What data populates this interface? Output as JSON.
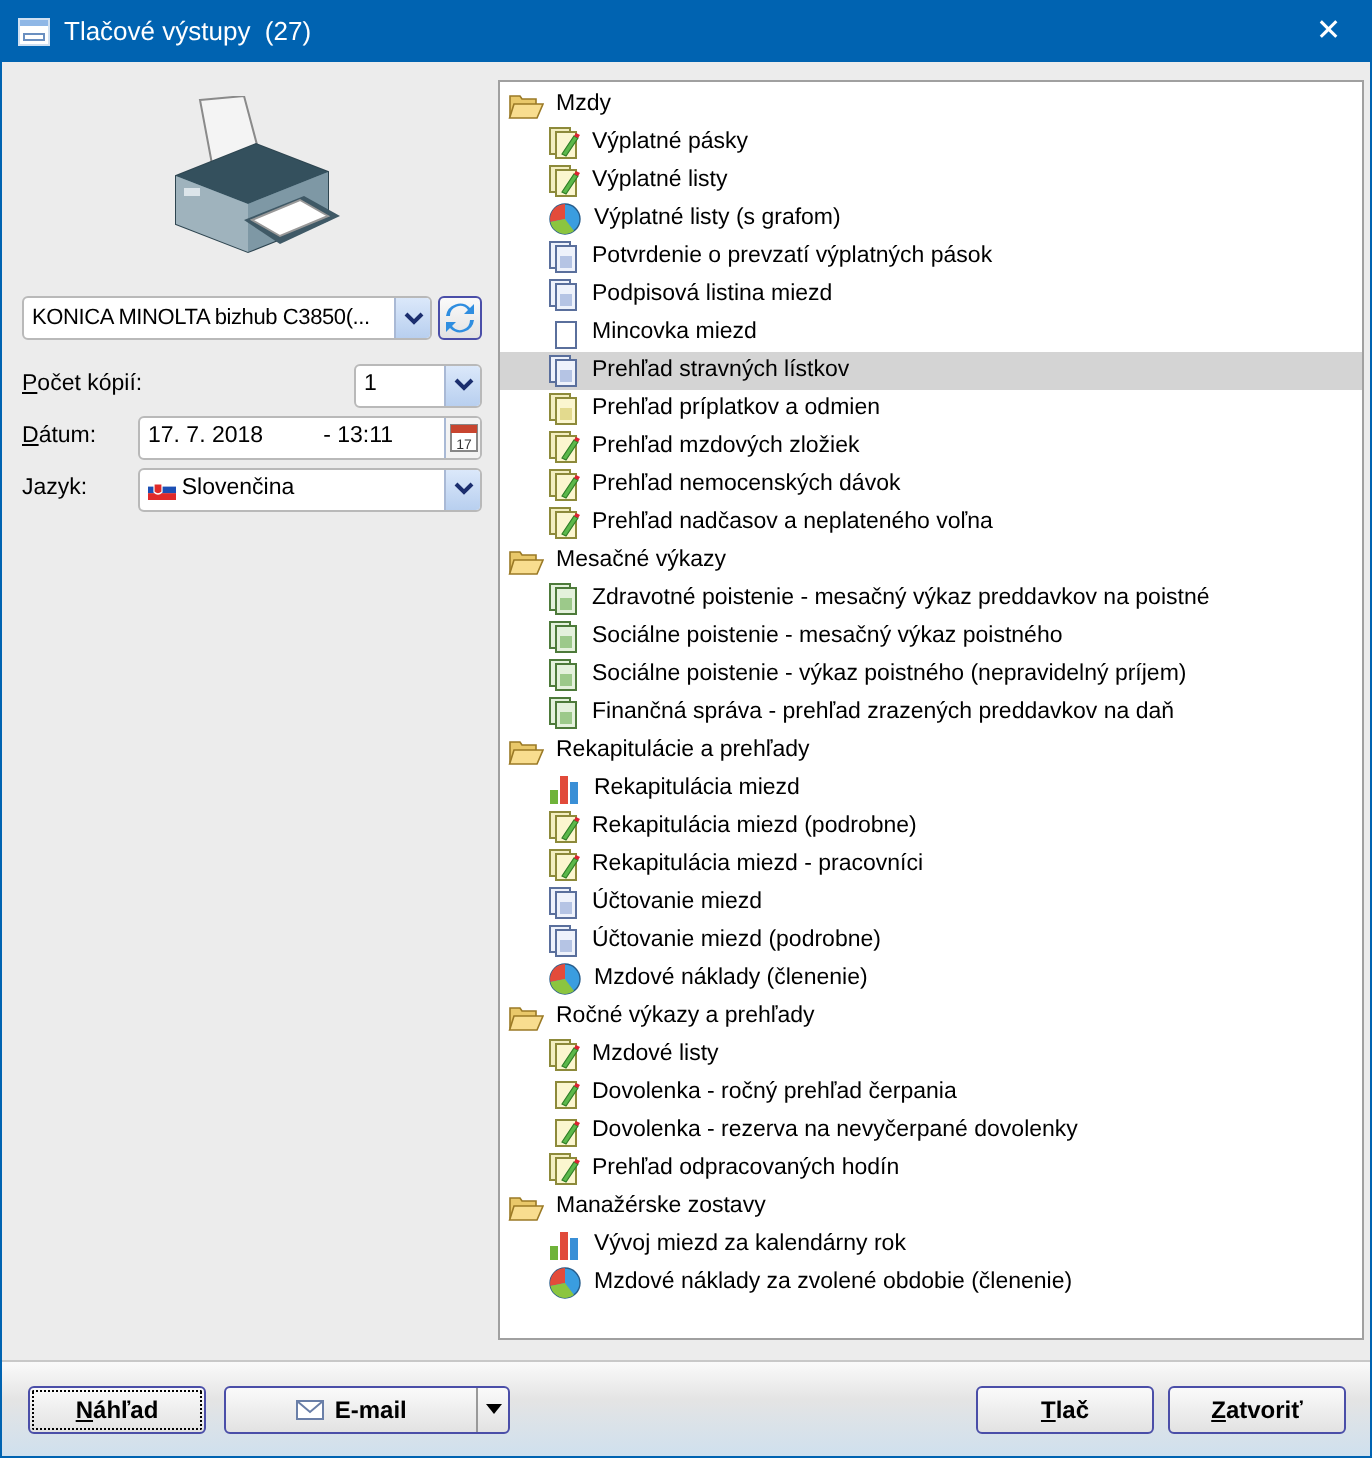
{
  "window": {
    "title": "Tlačové výstupy  (27)",
    "close": "✕"
  },
  "printer": {
    "value": "KONICA MINOLTA bizhub C3850(..."
  },
  "fields": [
    {
      "kind": "combo",
      "label": "Počet kópií:",
      "mnemonic": true,
      "value": "1"
    },
    {
      "kind": "date",
      "label": "Dátum:",
      "mnemonic": true,
      "value": "17. 7. 2018",
      "time": "- 13:11",
      "calendar_day": "17"
    },
    {
      "kind": "language",
      "label": "Jazyk:",
      "mnemonic": false,
      "value": "Slovenčina"
    }
  ],
  "tree": [
    {
      "label": "Mzdy",
      "expanded": true,
      "children": [
        {
          "label": "Výplatné pásky",
          "kind": "edit",
          "selected": false
        },
        {
          "label": "Výplatné listy",
          "kind": "edit",
          "selected": false
        },
        {
          "label": "Výplatné listy (s grafom)",
          "kind": "pie",
          "selected": false
        },
        {
          "label": "Potvrdenie o prevzatí výplatných pások",
          "kind": "pages",
          "selected": false
        },
        {
          "label": "Podpisová listina miezd",
          "kind": "pages",
          "selected": false
        },
        {
          "label": "Mincovka miezd",
          "kind": "page",
          "selected": false
        },
        {
          "label": "Prehľad stravných lístkov",
          "kind": "pages",
          "selected": true
        },
        {
          "label": "Prehľad príplatkov a odmien",
          "kind": "yellow",
          "selected": false
        },
        {
          "label": "Prehľad mzdových zložiek",
          "kind": "edit",
          "selected": false
        },
        {
          "label": "Prehľad nemocenských dávok",
          "kind": "edit",
          "selected": false
        },
        {
          "label": "Prehľad nadčasov a neplateného voľna",
          "kind": "edit",
          "selected": false
        }
      ]
    },
    {
      "label": "Mesačné výkazy",
      "expanded": true,
      "children": [
        {
          "label": "Zdravotné poistenie - mesačný výkaz preddavkov na poistné",
          "kind": "green",
          "selected": false
        },
        {
          "label": "Sociálne poistenie - mesačný výkaz poistného",
          "kind": "green",
          "selected": false
        },
        {
          "label": "Sociálne poistenie - výkaz poistného (nepravidelný príjem)",
          "kind": "green",
          "selected": false
        },
        {
          "label": "Finančná správa - prehľad zrazených preddavkov na daň",
          "kind": "green",
          "selected": false
        }
      ]
    },
    {
      "label": "Rekapitulácie a prehľady",
      "expanded": true,
      "children": [
        {
          "label": "Rekapitulácia miezd",
          "kind": "bars",
          "selected": false
        },
        {
          "label": "Rekapitulácia miezd (podrobne)",
          "kind": "edit",
          "selected": false
        },
        {
          "label": "Rekapitulácia miezd - pracovníci",
          "kind": "edit",
          "selected": false
        },
        {
          "label": "Účtovanie miezd",
          "kind": "pages",
          "selected": false
        },
        {
          "label": "Účtovanie miezd (podrobne)",
          "kind": "pages",
          "selected": false
        },
        {
          "label": "Mzdové náklady (členenie)",
          "kind": "pie",
          "selected": false
        }
      ]
    },
    {
      "label": "Ročné výkazy a prehľady",
      "expanded": true,
      "children": [
        {
          "label": "Mzdové listy",
          "kind": "edit",
          "selected": false
        },
        {
          "label": "Dovolenka - ročný prehľad čerpania",
          "kind": "edit1",
          "selected": false
        },
        {
          "label": "Dovolenka - rezerva na nevyčerpané dovolenky",
          "kind": "edit1",
          "selected": false
        },
        {
          "label": "Prehľad odpracovaných hodín",
          "kind": "edit",
          "selected": false
        }
      ]
    },
    {
      "label": "Manažérske zostavy",
      "expanded": true,
      "children": [
        {
          "label": "Vývoj miezd za kalendárny rok",
          "kind": "bars",
          "selected": false
        },
        {
          "label": "Mzdové náklady za zvolené obdobie (členenie)",
          "kind": "pie",
          "selected": false
        }
      ]
    }
  ],
  "buttons": [
    {
      "kind": "preview",
      "label": "Náhľad",
      "mnemonic": true
    },
    {
      "kind": "email",
      "label": "E-mail",
      "mnemonic": false
    },
    {
      "kind": "print",
      "label": "Tlač",
      "mnemonic": true
    },
    {
      "kind": "close",
      "label": "Zatvoriť",
      "mnemonic": true
    }
  ]
}
